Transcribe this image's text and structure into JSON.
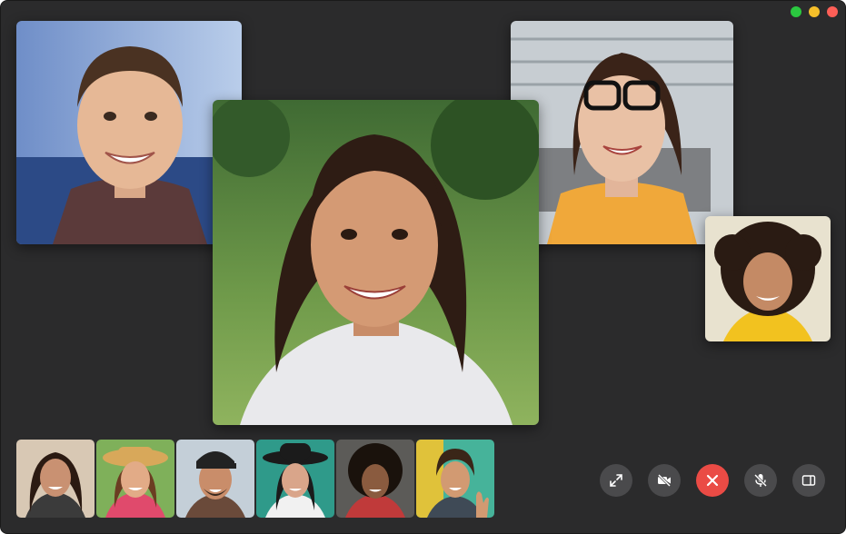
{
  "window": {
    "controls": [
      "zoom-button",
      "minimize-button",
      "close-button"
    ],
    "colors": {
      "zoom": "#2bc840",
      "minimize": "#f5bf2a",
      "close": "#fe5f57",
      "background": "#2b2b2c",
      "end_call": "#ea4b45"
    }
  },
  "participants_main": [
    {
      "id": "participant-top-left",
      "skin": "#e6b896",
      "hair": "#4a3222",
      "bg": "#7fa0d6"
    },
    {
      "id": "participant-center",
      "skin": "#d49a74",
      "hair": "#2e1c14",
      "bg": "#4f7a3e"
    },
    {
      "id": "participant-top-right",
      "skin": "#e9c1a5",
      "hair": "#3a2318",
      "bg": "#c7cdd2"
    },
    {
      "id": "participant-small-right",
      "skin": "#c48a65",
      "hair": "#2a1b13",
      "bg": "#e8e2cf"
    }
  ],
  "participants_row": [
    {
      "skin": "#c99172",
      "hair": "#2b1a12",
      "bg": "#d8c8b4"
    },
    {
      "skin": "#e2ab87",
      "hair": "#6b3d22",
      "bg": "#7fb05a"
    },
    {
      "skin": "#c98d6a",
      "hair": "#222222",
      "bg": "#c4cfd8"
    },
    {
      "skin": "#d9a58a",
      "hair": "#1b1b1b",
      "bg": "#2f9a8a"
    },
    {
      "skin": "#8a5b3f",
      "hair": "#1a120c",
      "bg": "#5c5b58"
    },
    {
      "skin": "#d29a72",
      "hair": "#3a2618",
      "bg": "#46b39a"
    }
  ],
  "call_controls": [
    {
      "name": "fullscreen-button",
      "icon": "fullscreen-icon"
    },
    {
      "name": "camera-off-button",
      "icon": "camera-off-icon"
    },
    {
      "name": "end-call-button",
      "icon": "end-call-icon"
    },
    {
      "name": "mute-button",
      "icon": "mic-off-icon"
    },
    {
      "name": "sidebar-button",
      "icon": "sidebar-icon"
    }
  ]
}
